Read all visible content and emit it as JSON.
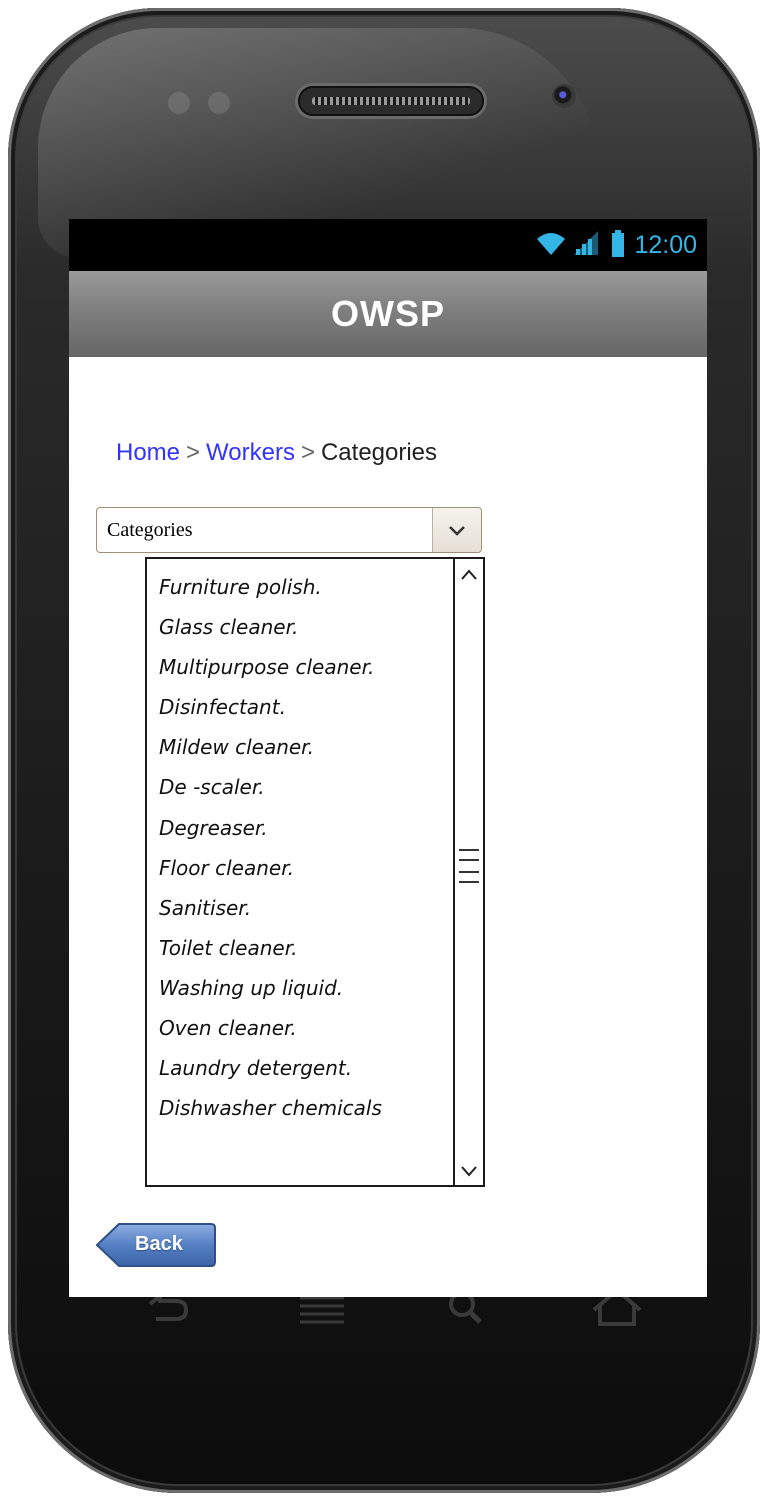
{
  "status_bar": {
    "time": "12:00",
    "icons": [
      "wifi-icon",
      "signal-icon",
      "battery-icon"
    ],
    "time_color": "#33b5e5"
  },
  "header": {
    "title": "OWSP"
  },
  "breadcrumb": {
    "items": [
      {
        "label": "Home",
        "link": true
      },
      {
        "label": "Workers",
        "link": true
      },
      {
        "label": "Categories",
        "link": false
      }
    ],
    "separator": ">"
  },
  "category_select": {
    "selected": "Categories",
    "icon": "chevron-down-icon"
  },
  "category_list": {
    "items": [
      "Furniture polish.",
      "Glass cleaner.",
      "Multipurpose cleaner.",
      "Disinfectant.",
      "Mildew cleaner.",
      "De -scaler.",
      "Degreaser.",
      "Floor cleaner.",
      "Sanitiser.",
      "Toilet cleaner.",
      "Washing up liquid.",
      "Oven cleaner.",
      "Laundry detergent.",
      "Dishwasher chemicals"
    ]
  },
  "back_button": {
    "label": "Back",
    "color": "#4a73b5"
  },
  "nav_keys": [
    "back-nav-icon",
    "menu-nav-icon",
    "search-nav-icon",
    "home-nav-icon"
  ]
}
